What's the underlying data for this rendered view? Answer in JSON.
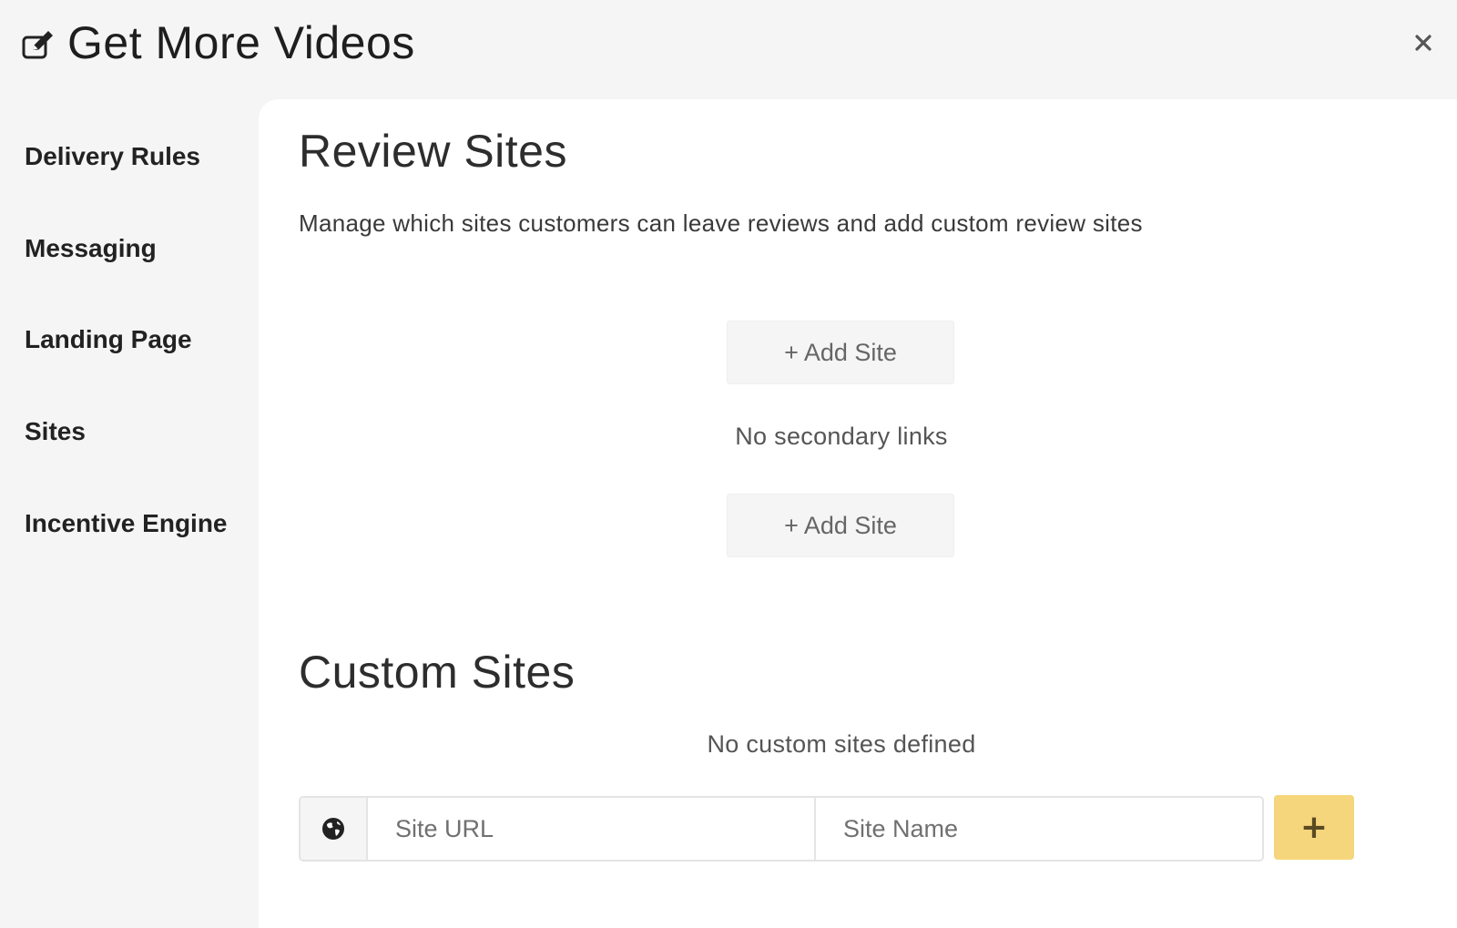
{
  "header": {
    "title": "Get More Videos",
    "icon": "edit-icon",
    "close_icon": "close-icon"
  },
  "sidebar": {
    "items": [
      {
        "label": "Delivery Rules"
      },
      {
        "label": "Messaging"
      },
      {
        "label": "Landing Page"
      },
      {
        "label": "Sites"
      },
      {
        "label": "Incentive Engine"
      }
    ]
  },
  "review_sites": {
    "title": "Review Sites",
    "description": "Manage which sites customers can leave reviews and add custom review sites",
    "add_primary_label": "+ Add Site",
    "no_secondary_text": "No secondary links",
    "add_secondary_label": "+ Add Site"
  },
  "custom_sites": {
    "title": "Custom Sites",
    "empty_text": "No custom sites defined",
    "url_placeholder": "Site URL",
    "name_placeholder": "Site Name",
    "globe_icon": "globe-icon",
    "add_button_label": "+",
    "add_button_color": "#f6d67c"
  }
}
